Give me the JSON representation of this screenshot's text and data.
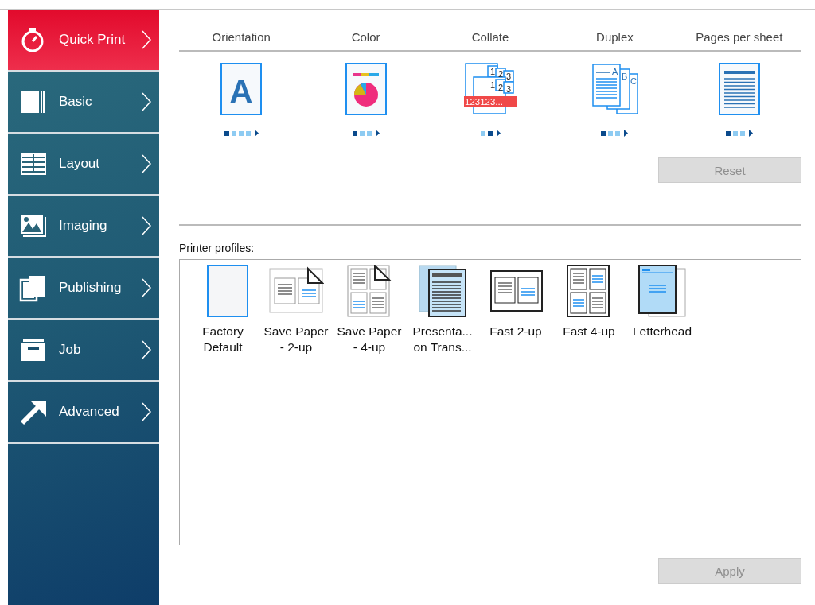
{
  "sidebar": {
    "items": [
      {
        "label": "Quick Print",
        "kind": "stopwatch",
        "selected": true
      },
      {
        "label": "Basic",
        "kind": "page",
        "selected": false
      },
      {
        "label": "Layout",
        "kind": "layout",
        "selected": false
      },
      {
        "label": "Imaging",
        "kind": "image",
        "selected": false
      },
      {
        "label": "Publishing",
        "kind": "publishing",
        "selected": false
      },
      {
        "label": "Job",
        "kind": "job",
        "selected": false
      },
      {
        "label": "Advanced",
        "kind": "arrow",
        "selected": false
      }
    ]
  },
  "settings": [
    {
      "label": "Orientation",
      "kind": "orientation",
      "icon_texts": [
        "A"
      ],
      "options": [
        {
          "selected": true
        },
        {
          "selected": false
        },
        {
          "selected": false
        },
        {
          "selected": false
        }
      ]
    },
    {
      "label": "Color",
      "kind": "color",
      "options": [
        {
          "selected": true
        },
        {
          "selected": false
        },
        {
          "selected": false
        }
      ]
    },
    {
      "label": "Collate",
      "kind": "collate",
      "icon_texts": [
        "1",
        "2",
        "3",
        "1",
        "2",
        "3",
        "123123..."
      ],
      "options": [
        {
          "selected": false
        },
        {
          "selected": true
        }
      ]
    },
    {
      "label": "Duplex",
      "kind": "duplex",
      "icon_texts": [
        "A",
        "B",
        "C"
      ],
      "options": [
        {
          "selected": true
        },
        {
          "selected": false
        },
        {
          "selected": false
        }
      ]
    },
    {
      "label": "Pages per sheet",
      "kind": "pages",
      "options": [
        {
          "selected": true
        },
        {
          "selected": false
        },
        {
          "selected": false
        }
      ]
    }
  ],
  "reset_button": {
    "label": "Reset",
    "disabled": true
  },
  "profiles": {
    "label": "Printer profiles:",
    "items": [
      {
        "label": "Factory\nDefault",
        "kind": "blank"
      },
      {
        "label": "Save Paper\n- 2-up",
        "kind": "save2"
      },
      {
        "label": "Save Paper\n- 4-up",
        "kind": "save4"
      },
      {
        "label": "Presenta...\non Trans...",
        "kind": "transparency"
      },
      {
        "label": "Fast 2-up",
        "kind": "fast2"
      },
      {
        "label": "Fast 4-up",
        "kind": "fast4"
      },
      {
        "label": "Letterhead",
        "kind": "letterhead"
      }
    ]
  },
  "apply_button": {
    "label": "Apply",
    "disabled": true
  }
}
